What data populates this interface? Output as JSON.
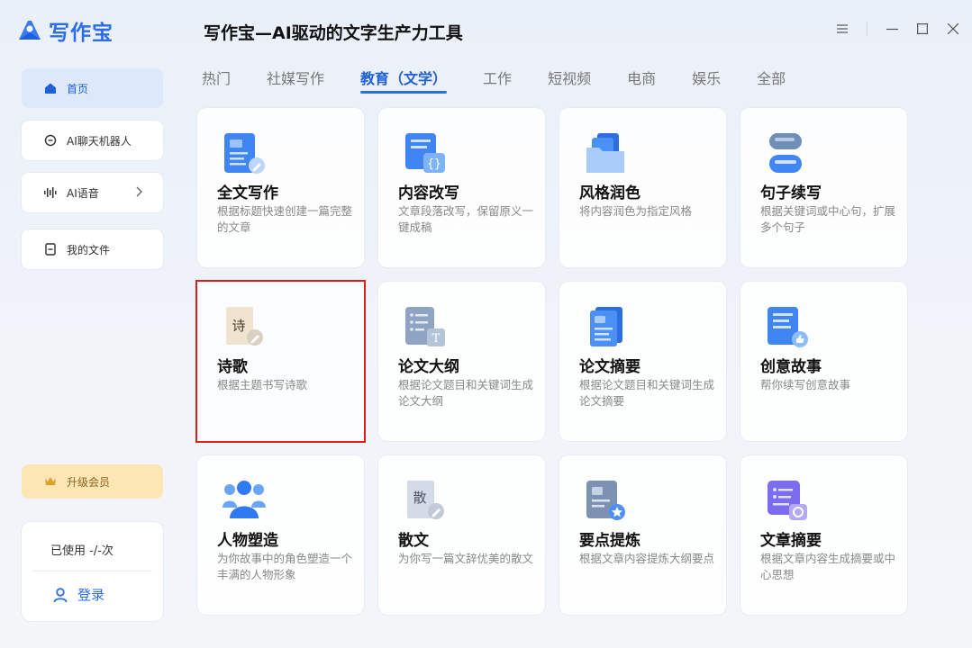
{
  "app": {
    "logo_text": "写作宝",
    "title": "写作宝—AI驱动的文字生产力工具"
  },
  "sidebar": {
    "items": [
      {
        "label": "首页",
        "icon": "home-icon",
        "active": true
      },
      {
        "label": "AI聊天机器人",
        "icon": "chat-icon"
      },
      {
        "label": "AI语音",
        "icon": "voice-wave-icon"
      },
      {
        "label": "我的文件",
        "icon": "file-icon"
      }
    ],
    "vip_label": "升级会员",
    "usage_text": "已使用 -/-次",
    "login_label": "登录"
  },
  "tabs": [
    {
      "label": "热门"
    },
    {
      "label": "社媒写作"
    },
    {
      "label": "教育（文学）",
      "active": true
    },
    {
      "label": "工作"
    },
    {
      "label": "短视频"
    },
    {
      "label": "电商"
    },
    {
      "label": "娱乐"
    },
    {
      "label": "全部"
    }
  ],
  "cards": [
    {
      "title": "全文写作",
      "desc": "根据标题快速创建一篇完整的文章",
      "icon": "full-text-doc-icon"
    },
    {
      "title": "内容改写",
      "desc": "文章段落改写，保留原义一键成稿",
      "icon": "rewrite-code-doc-icon"
    },
    {
      "title": "风格润色",
      "desc": "将内容润色为指定风格",
      "icon": "style-folder-icon"
    },
    {
      "title": "句子续写",
      "desc": "根据关键词或中心句，扩展多个句子",
      "icon": "sentence-continue-icon"
    },
    {
      "title": "诗歌",
      "desc": "根据主题书写诗歌",
      "icon": "poem-scroll-icon",
      "icon_glyph": "诗",
      "selected": true
    },
    {
      "title": "论文大纲",
      "desc": "根据论文题目和关键词生成论文大纲",
      "icon": "outline-doc-icon"
    },
    {
      "title": "论文摘要",
      "desc": "根据论文题目和关键词生成论文摘要",
      "icon": "abstract-doc-icon"
    },
    {
      "title": "创意故事",
      "desc": "帮你续写创意故事",
      "icon": "story-like-doc-icon"
    },
    {
      "title": "人物塑造",
      "desc": "为你故事中的角色塑造一个丰满的人物形象",
      "icon": "people-group-icon"
    },
    {
      "title": "散文",
      "desc": "为你写一篇文辞优美的散文",
      "icon": "prose-scroll-icon",
      "icon_glyph": "散"
    },
    {
      "title": "要点提炼",
      "desc": "根据文章内容提炼大纲要点",
      "icon": "key-points-doc-icon"
    },
    {
      "title": "文章摘要",
      "desc": "根据文章内容生成摘要或中心思想",
      "icon": "article-summary-icon"
    }
  ],
  "colors": {
    "accent": "#2b6de8",
    "vip_bg": "#fbe6b4",
    "selected_outline": "#d62020"
  }
}
